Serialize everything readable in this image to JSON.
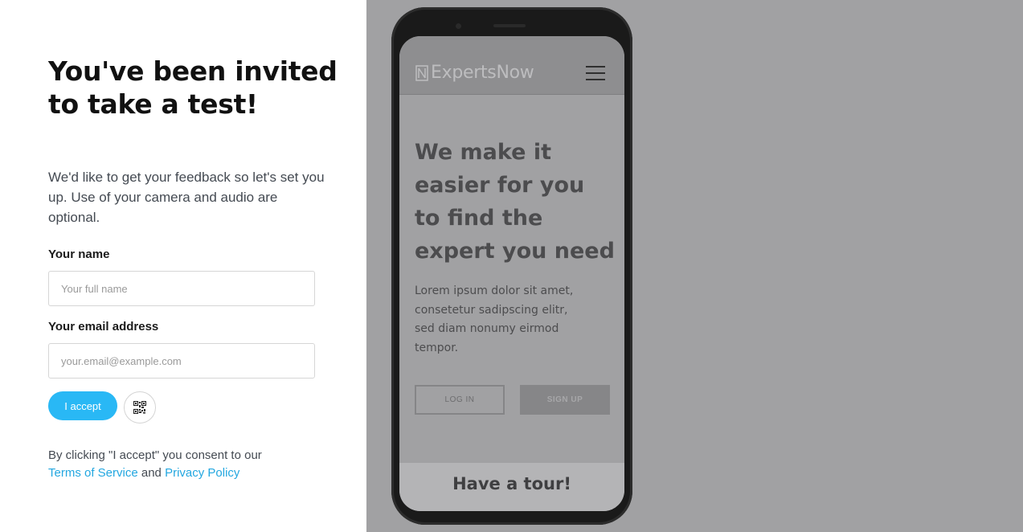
{
  "form": {
    "title": "You've been invited to take a test!",
    "description": "We'd like to get your feedback so let's set you up. Use of your camera and audio are optional.",
    "name_label": "Your name",
    "name_placeholder": "Your full name",
    "email_label": "Your email address",
    "email_placeholder": "your.email@example.com",
    "accept_label": "I accept",
    "qr_icon": "qr-code-icon",
    "consent_text": "By clicking \"I accept\" you consent to our",
    "terms_link": "Terms of Service",
    "and_text": "and",
    "privacy_link": "Privacy Policy"
  },
  "preview": {
    "brand": "ExpertsNow",
    "brand_icon": "expertsnow-logo",
    "menu_icon": "hamburger-menu-icon",
    "headline": "We make it easier for you to find the expert you need",
    "body": "Lorem ipsum dolor sit amet, consetetur sadipscing elitr, sed diam nonumy eirmod tempor.",
    "login_label": "LOG IN",
    "signup_label": "SIGN UP",
    "tour_label": "Have a tour!"
  },
  "colors": {
    "accent": "#29b8f5",
    "link": "#23a7e0",
    "overlay": "#a1a1a3"
  }
}
